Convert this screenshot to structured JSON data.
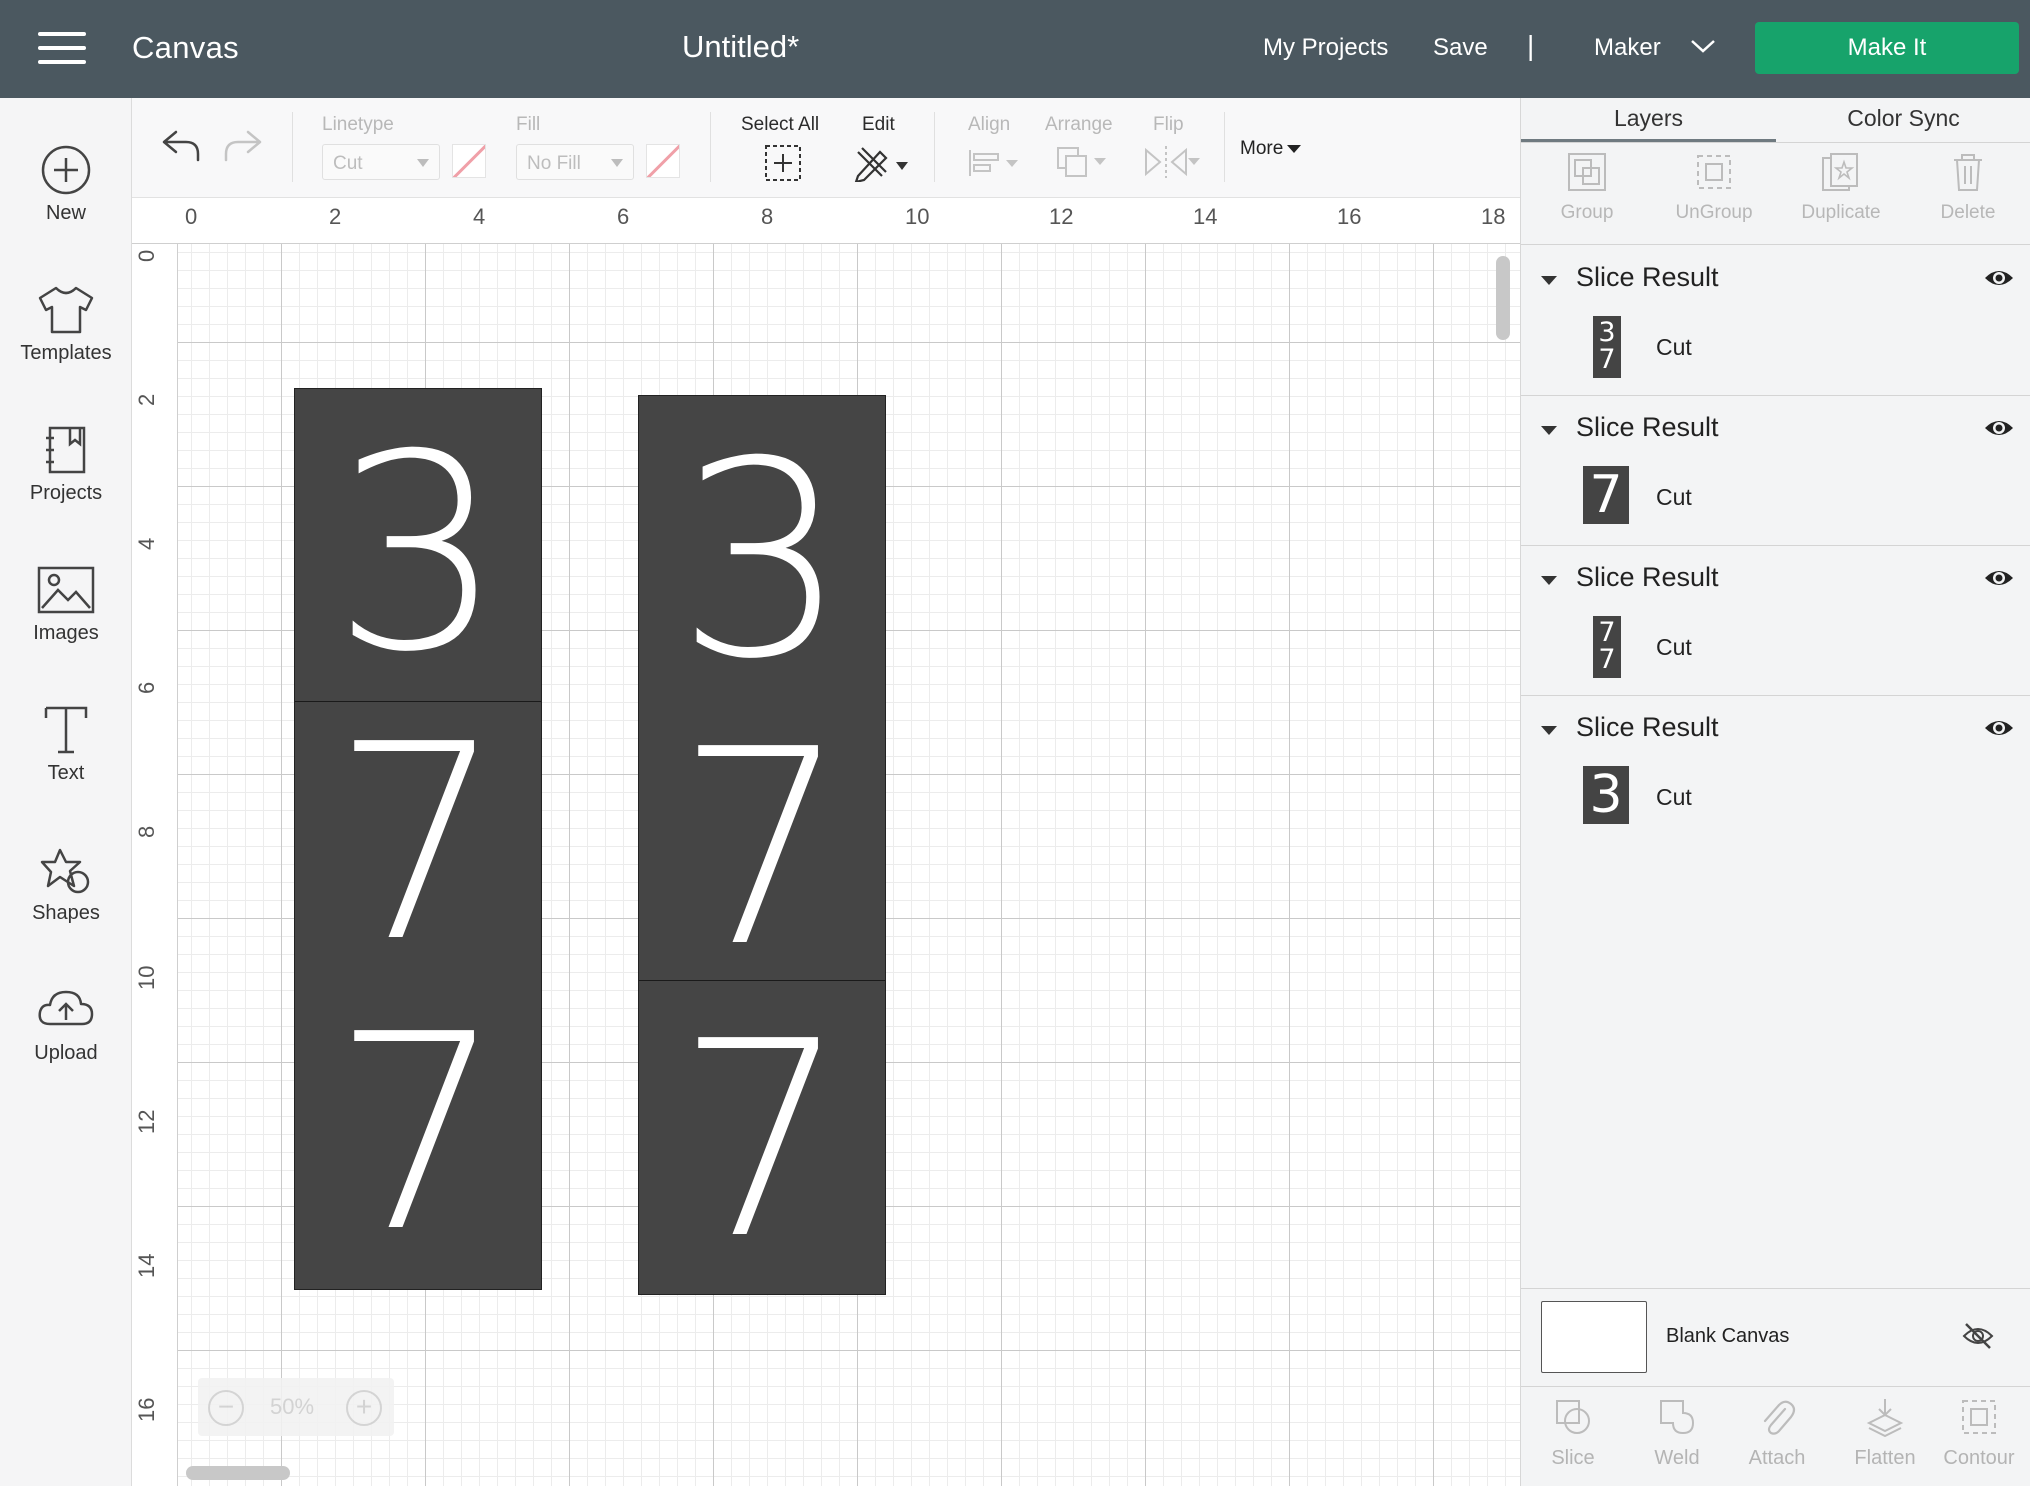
{
  "header": {
    "app_title": "Canvas",
    "doc_title": "Untitled*",
    "my_projects": "My Projects",
    "save": "Save",
    "separator": "|",
    "machine": "Maker",
    "make_it": "Make It",
    "make_it_color": "#17a36b",
    "bar_color": "#4b5860"
  },
  "sidebar": {
    "items": [
      {
        "label": "New",
        "icon": "plus-circle-icon"
      },
      {
        "label": "Templates",
        "icon": "tshirt-icon"
      },
      {
        "label": "Projects",
        "icon": "notebook-icon"
      },
      {
        "label": "Images",
        "icon": "image-icon"
      },
      {
        "label": "Text",
        "icon": "text-t-icon"
      },
      {
        "label": "Shapes",
        "icon": "shapes-icon"
      },
      {
        "label": "Upload",
        "icon": "cloud-upload-icon"
      }
    ]
  },
  "toolbar": {
    "linetype_label": "Linetype",
    "linetype_value": "Cut",
    "fill_label": "Fill",
    "fill_value": "No Fill",
    "select_all": "Select All",
    "edit": "Edit",
    "align": "Align",
    "arrange": "Arrange",
    "flip": "Flip",
    "more": "More"
  },
  "canvas": {
    "ruler_x": [
      "0",
      "2",
      "4",
      "6",
      "8",
      "10",
      "12",
      "14",
      "16",
      "18"
    ],
    "ruler_y": [
      "0",
      "2",
      "4",
      "6",
      "8",
      "10",
      "12",
      "14",
      "16"
    ],
    "zoom": "50%",
    "zoom_minus": "−",
    "zoom_plus": "+",
    "board_left": {
      "digits": [
        "3",
        "7",
        "7"
      ]
    },
    "board_right": {
      "digits": [
        "3",
        "7",
        "7"
      ]
    }
  },
  "panel": {
    "tabs": [
      "Layers",
      "Color Sync"
    ],
    "actions": [
      "Group",
      "UnGroup",
      "Duplicate",
      "Delete"
    ],
    "layers": [
      {
        "name": "Slice Result",
        "sub": "Cut",
        "thumb": "3 7"
      },
      {
        "name": "Slice Result",
        "sub": "Cut",
        "thumb": "7"
      },
      {
        "name": "Slice Result",
        "sub": "Cut",
        "thumb": "7 7"
      },
      {
        "name": "Slice Result",
        "sub": "Cut",
        "thumb": "3"
      }
    ],
    "blank_canvas": "Blank Canvas",
    "bottom_actions": [
      "Slice",
      "Weld",
      "Attach",
      "Flatten",
      "Contour"
    ]
  }
}
